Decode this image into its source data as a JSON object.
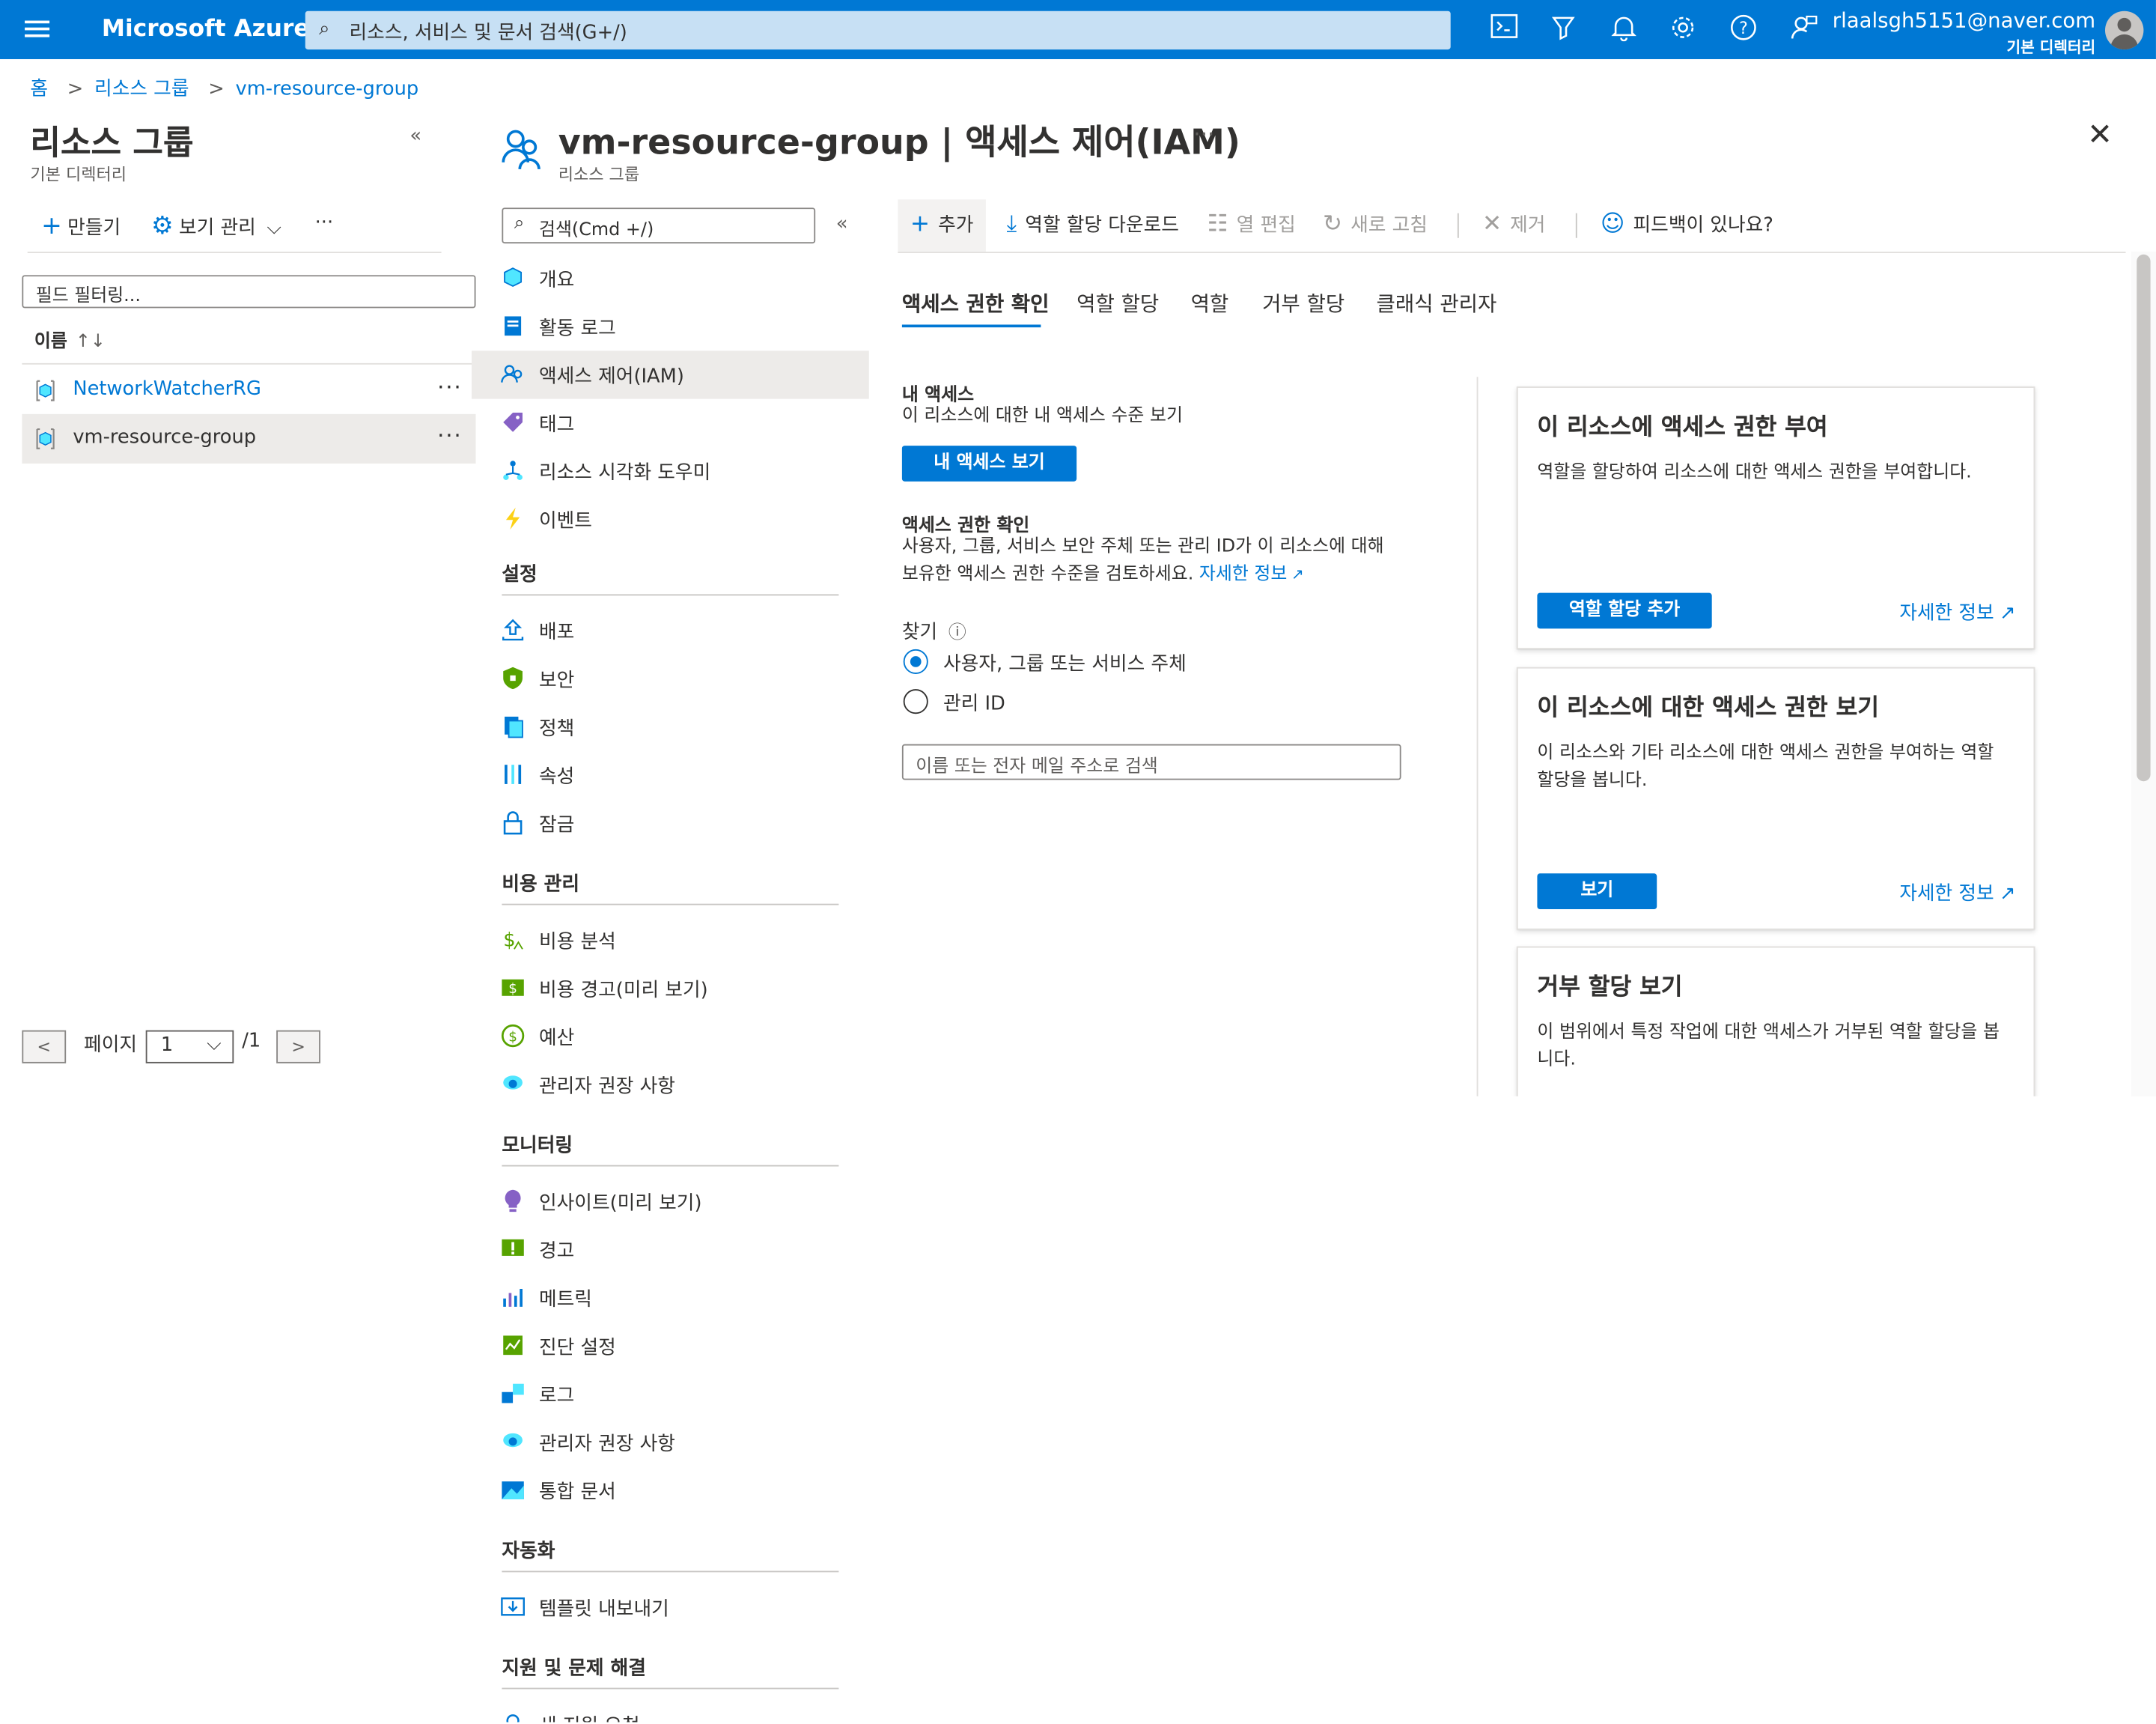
{
  "topbar": {
    "brand": "Microsoft Azure",
    "search_placeholder": "리소스, 서비스 및 문서 검색(G+/)",
    "icons": [
      "cloud-shell-icon",
      "directory-filter-icon",
      "bell-icon",
      "gear-icon",
      "help-icon",
      "feedback-icon"
    ],
    "user_email": "rlaalsgh5151@naver.com",
    "user_directory": "기본 디렉터리"
  },
  "breadcrumb": {
    "home": "홈",
    "resource_groups": "리소스 그룹",
    "current": "vm-resource-group",
    "separator": ">"
  },
  "left": {
    "title": "리소스 그룹",
    "subtitle": "기본 디렉터리",
    "collapse": "«",
    "create": "만들기",
    "manage_view": "보기 관리",
    "more": "···",
    "filter_placeholder": "필드 필터링...",
    "column_name": "이름",
    "sort_glyph": "↑↓",
    "rows": [
      {
        "name": "NetworkWatcherRG",
        "selected": false
      },
      {
        "name": "vm-resource-group",
        "selected": true
      }
    ],
    "row_dots": "···",
    "pager": {
      "prev": "<",
      "label": "페이지",
      "current": "1",
      "total": "/1",
      "next": ">"
    }
  },
  "main": {
    "title": "vm-resource-group | 액세스 제어(IAM)",
    "subtitle": "리소스 그룹",
    "more": "···",
    "close": "✕",
    "search_placeholder": "검색(Cmd +/)",
    "collapse": "«",
    "nav_top": [
      {
        "label": "개요",
        "icon": "overview-icon",
        "color": "#49c5f1"
      },
      {
        "label": "활동 로그",
        "icon": "activity-log-icon",
        "color": "#0078d4"
      },
      {
        "label": "액세스 제어(IAM)",
        "icon": "iam-icon",
        "color": "#0078d4",
        "active": true
      },
      {
        "label": "태그",
        "icon": "tag-icon",
        "color": "#8661c5"
      },
      {
        "label": "리소스 시각화 도우미",
        "icon": "resource-visualizer-icon",
        "color": "#0078d4"
      },
      {
        "label": "이벤트",
        "icon": "events-icon",
        "color": "#fcd116"
      }
    ],
    "sections": [
      {
        "title": "설정",
        "items": [
          {
            "label": "배포",
            "icon": "deployments-icon",
            "color": "#0078d4"
          },
          {
            "label": "보안",
            "icon": "security-icon",
            "color": "#57a300"
          },
          {
            "label": "정책",
            "icon": "policies-icon",
            "color": "#0078d4"
          },
          {
            "label": "속성",
            "icon": "properties-icon",
            "color": "#0078d4"
          },
          {
            "label": "잠금",
            "icon": "locks-icon",
            "color": "#0078d4"
          }
        ]
      },
      {
        "title": "비용 관리",
        "items": [
          {
            "label": "비용 분석",
            "icon": "cost-analysis-icon",
            "color": "#57a300"
          },
          {
            "label": "비용 경고(미리 보기)",
            "icon": "cost-alerts-icon",
            "color": "#57a300"
          },
          {
            "label": "예산",
            "icon": "budgets-icon",
            "color": "#57a300"
          },
          {
            "label": "관리자 권장 사항",
            "icon": "advisor-icon",
            "color": "#0078d4"
          }
        ]
      },
      {
        "title": "모니터링",
        "items": [
          {
            "label": "인사이트(미리 보기)",
            "icon": "insights-icon",
            "color": "#8661c5"
          },
          {
            "label": "경고",
            "icon": "alerts-icon",
            "color": "#57a300"
          },
          {
            "label": "메트릭",
            "icon": "metrics-icon",
            "color": "#0078d4"
          },
          {
            "label": "진단 설정",
            "icon": "diagnostic-settings-icon",
            "color": "#57a300"
          },
          {
            "label": "로그",
            "icon": "logs-icon",
            "color": "#0078d4"
          },
          {
            "label": "관리자 권장 사항",
            "icon": "advisor-icon",
            "color": "#0078d4"
          },
          {
            "label": "통합 문서",
            "icon": "workbooks-icon",
            "color": "#0078d4"
          }
        ]
      },
      {
        "title": "자동화",
        "items": [
          {
            "label": "템플릿 내보내기",
            "icon": "export-template-icon",
            "color": "#0078d4"
          }
        ]
      },
      {
        "title": "지원 및 문제 해결",
        "items": [
          {
            "label": "새 지원 요청",
            "icon": "support-request-icon",
            "color": "#0078d4"
          }
        ]
      }
    ]
  },
  "toolbar": {
    "add": "추가",
    "download": "역할 할당 다운로드",
    "edit_columns": "열 편집",
    "refresh": "새로 고침",
    "remove": "제거",
    "feedback": "피드백이 있나요?"
  },
  "tabs": [
    "액세스 권한 확인",
    "역할 할당",
    "역할",
    "거부 할당",
    "클래식 관리자"
  ],
  "check_access": {
    "my_access_title": "내 액세스",
    "my_access_desc": "이 리소스에 대한 내 액세스 수준 보기",
    "my_access_button": "내 액세스 보기",
    "check_title": "액세스 권한 확인",
    "check_desc_1": "사용자, 그룹, 서비스 보안 주체 또는 관리 ID가 이 리소스에 대해",
    "check_desc_2": "보유한 액세스 권한 수준을 검토하세요.",
    "learn_more": "자세한 정보",
    "find_label": "찾기",
    "info_glyph": "ⓘ",
    "radio_1": "사용자, 그룹 또는 서비스 주체",
    "radio_2": "관리 ID",
    "search_placeholder": "이름 또는 전자 메일 주소로 검색"
  },
  "cards": [
    {
      "title": "이 리소스에 액세스 권한 부여",
      "desc": "역할을 할당하여 리소스에 대한 액세스 권한을 부여합니다.",
      "button": "역할 할당 추가",
      "link": "자세한 정보"
    },
    {
      "title": "이 리소스에 대한 액세스 권한 보기",
      "desc": "이 리소스와 기타 리소스에 대한 액세스 권한을 부여하는 역할 할당을 봅니다.",
      "button": "보기",
      "link": "자세한 정보"
    },
    {
      "title": "거부 할당 보기",
      "desc": "이 범위에서 특정 작업에 대한 액세스가 거부된 역할 할당을 봅니다."
    }
  ]
}
